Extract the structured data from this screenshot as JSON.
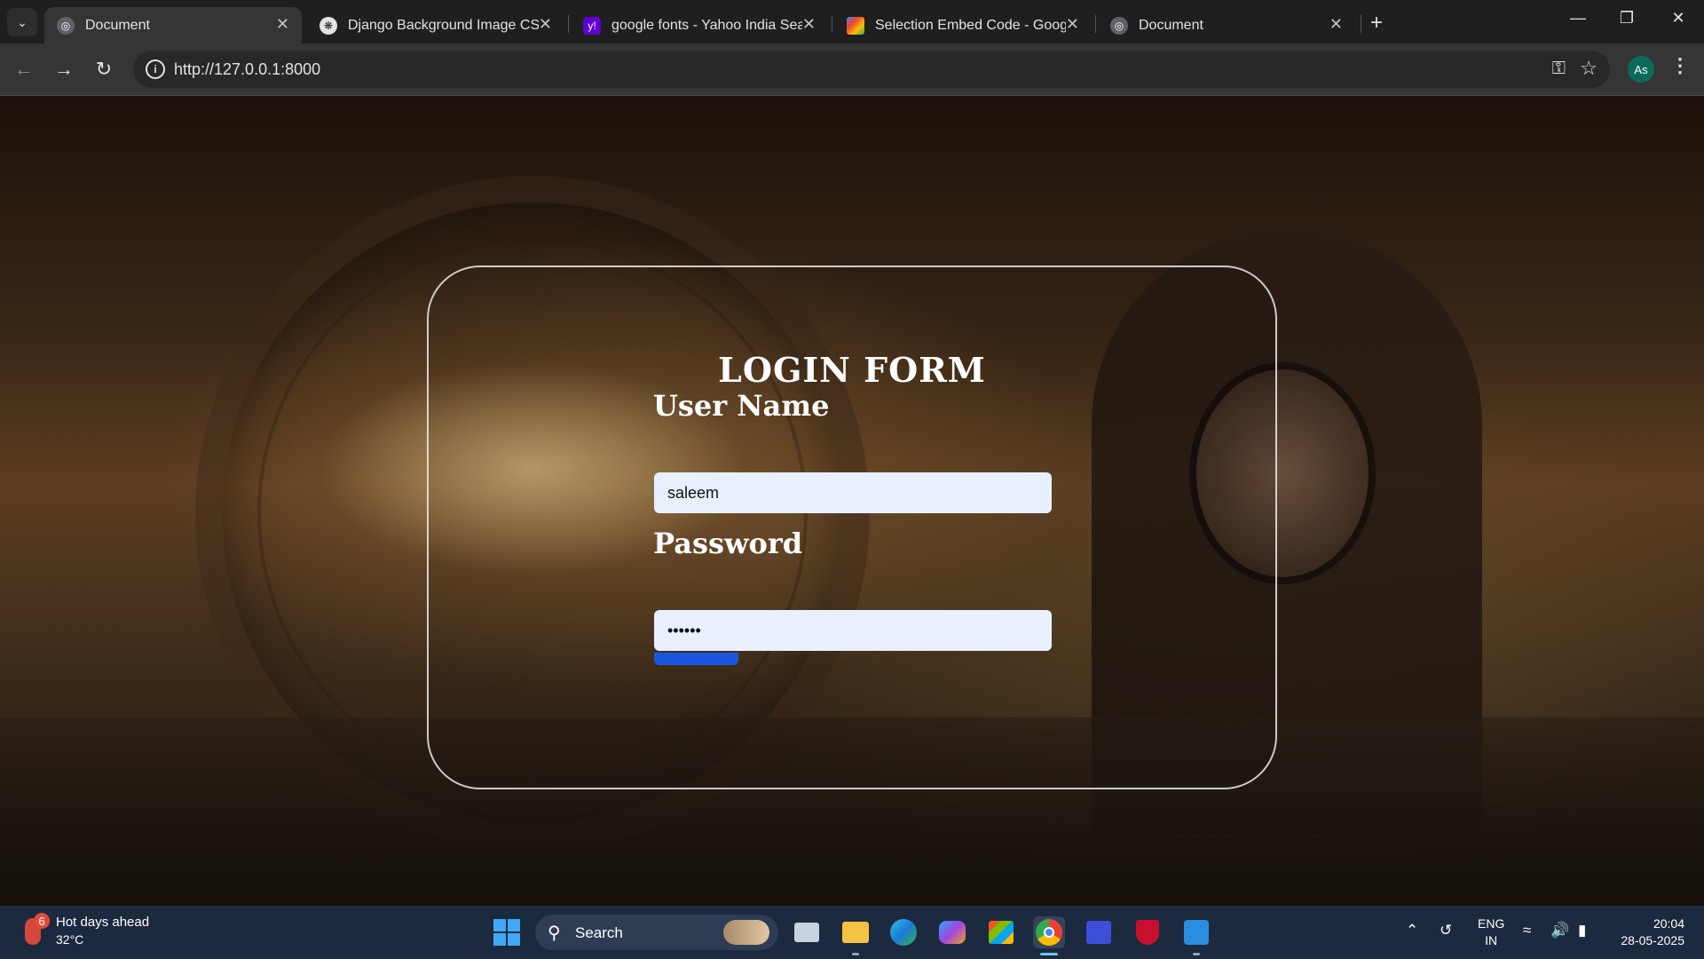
{
  "browser": {
    "tabs": [
      {
        "title": "Document",
        "favicon": "globe-icon",
        "active": true
      },
      {
        "title": "Django Background Image CSS",
        "favicon": "openai-icon",
        "active": false
      },
      {
        "title": "google fonts - Yahoo India Sear",
        "favicon": "yahoo-icon",
        "active": false
      },
      {
        "title": "Selection Embed Code - Googl",
        "favicon": "google-fonts-icon",
        "active": false
      },
      {
        "title": "Document",
        "favicon": "globe-icon",
        "active": false
      }
    ],
    "url": "http://127.0.0.1:8000",
    "profile_initials": "As"
  },
  "page": {
    "title": "LOGIN FORM",
    "username_label": "User Name",
    "username_value": "saleem",
    "password_label": "Password",
    "password_value": "••••••"
  },
  "taskbar": {
    "weather_badge": "6",
    "weather_title": "Hot days ahead",
    "weather_temp": "32°C",
    "search_label": "Search",
    "lang_top": "ENG",
    "lang_bottom": "IN",
    "time": "20:04",
    "date": "28-05-2025"
  },
  "colors": {
    "accent_blue": "#1a57e0",
    "input_bg": "#e8f0fe",
    "taskbar_bg": "#1c2a3f"
  }
}
